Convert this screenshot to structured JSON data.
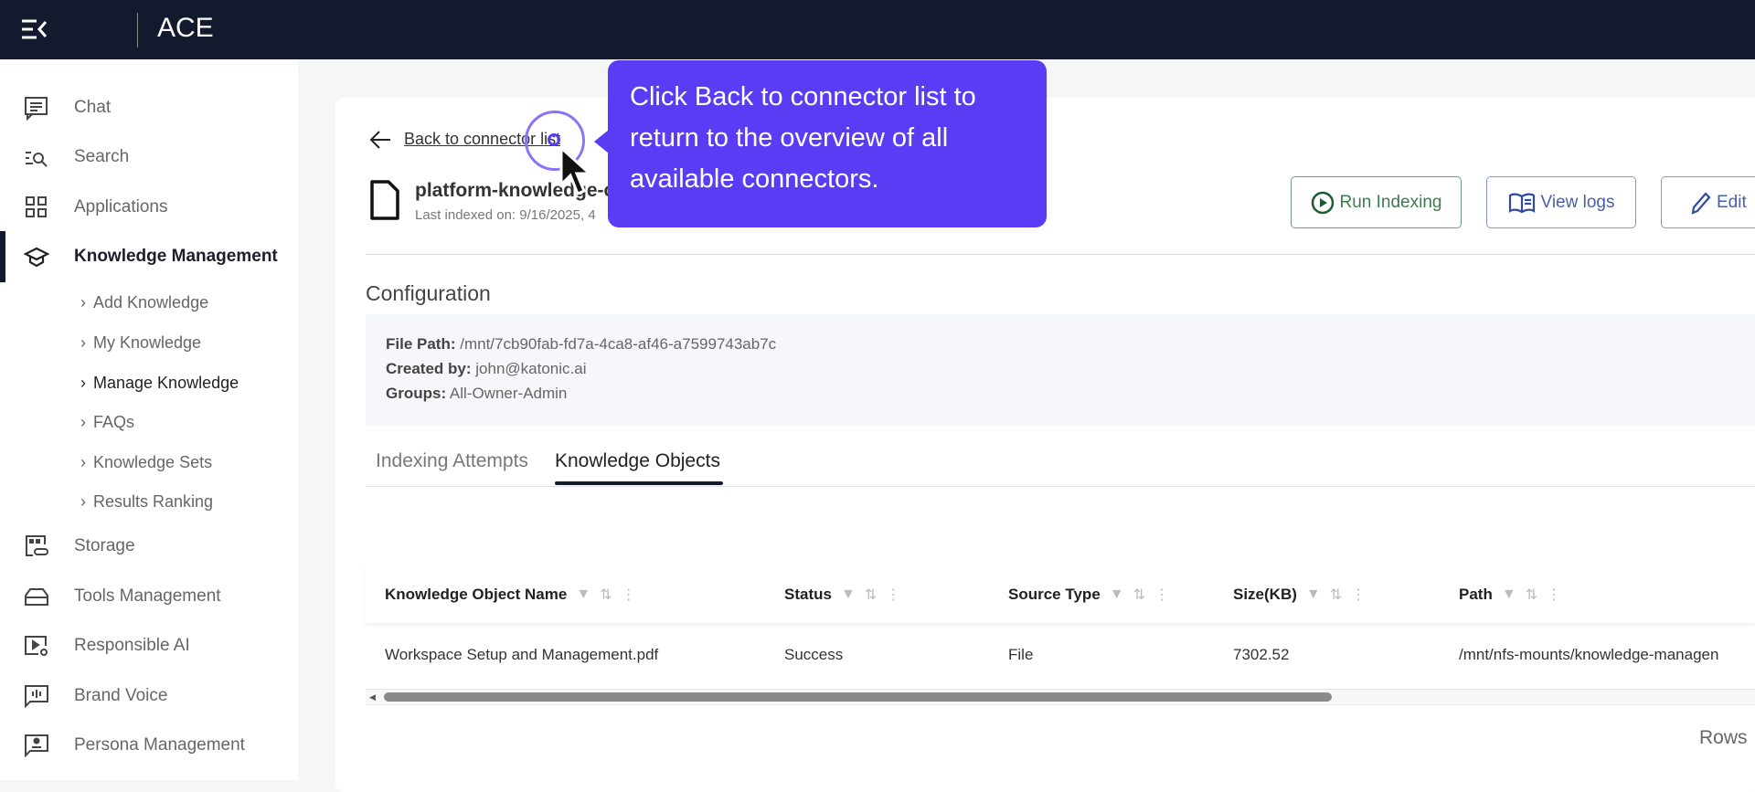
{
  "header": {
    "app_title": "ACE"
  },
  "sidebar": {
    "items": [
      {
        "label": "Chat",
        "icon": "chat-icon"
      },
      {
        "label": "Search",
        "icon": "search-icon"
      },
      {
        "label": "Applications",
        "icon": "grid-icon"
      },
      {
        "label": "Knowledge Management",
        "icon": "graduation-cap-icon"
      },
      {
        "label": "Storage",
        "icon": "storage-icon"
      },
      {
        "label": "Tools Management",
        "icon": "toolbox-icon"
      },
      {
        "label": "Responsible AI",
        "icon": "video-settings-icon"
      },
      {
        "label": "Brand Voice",
        "icon": "voice-icon"
      },
      {
        "label": "Persona Management",
        "icon": "persona-icon"
      }
    ],
    "subitems": [
      "Add Knowledge",
      "My Knowledge",
      "Manage Knowledge",
      "FAQs",
      "Knowledge Sets",
      "Results Ranking"
    ]
  },
  "main": {
    "back_label": "Back to connector list",
    "connector_title": "platform-knowledge-c",
    "last_indexed": "Last indexed on: 9/16/2025, 4",
    "buttons": {
      "run": "Run Indexing",
      "logs": "View logs",
      "edit": "Edit"
    },
    "config_title": "Configuration",
    "config": {
      "file_path_label": "File Path:",
      "file_path": "/mnt/7cb90fab-fd7a-4ca8-af46-a7599743ab7c",
      "created_label": "Created by:",
      "created": "john@katonic.ai",
      "groups_label": "Groups:",
      "groups": "All-Owner-Admin"
    },
    "tabs": [
      "Indexing Attempts",
      "Knowledge Objects"
    ],
    "table": {
      "columns": [
        "Knowledge Object Name",
        "Status",
        "Source Type",
        "Size(KB)",
        "Path"
      ],
      "rows": [
        [
          "Workspace Setup and Management.pdf",
          "Success",
          "File",
          "7302.52",
          "/mnt/nfs-mounts/knowledge-managen"
        ]
      ]
    },
    "rows_label": "Rows"
  },
  "tooltip": {
    "text": "Click Back to connector list to return to the overview of all available connectors."
  },
  "colors": {
    "accent": "#5b3cf5",
    "header": "#131a2e",
    "run": "#2e6b3f",
    "logs": "#2f4aa0"
  }
}
